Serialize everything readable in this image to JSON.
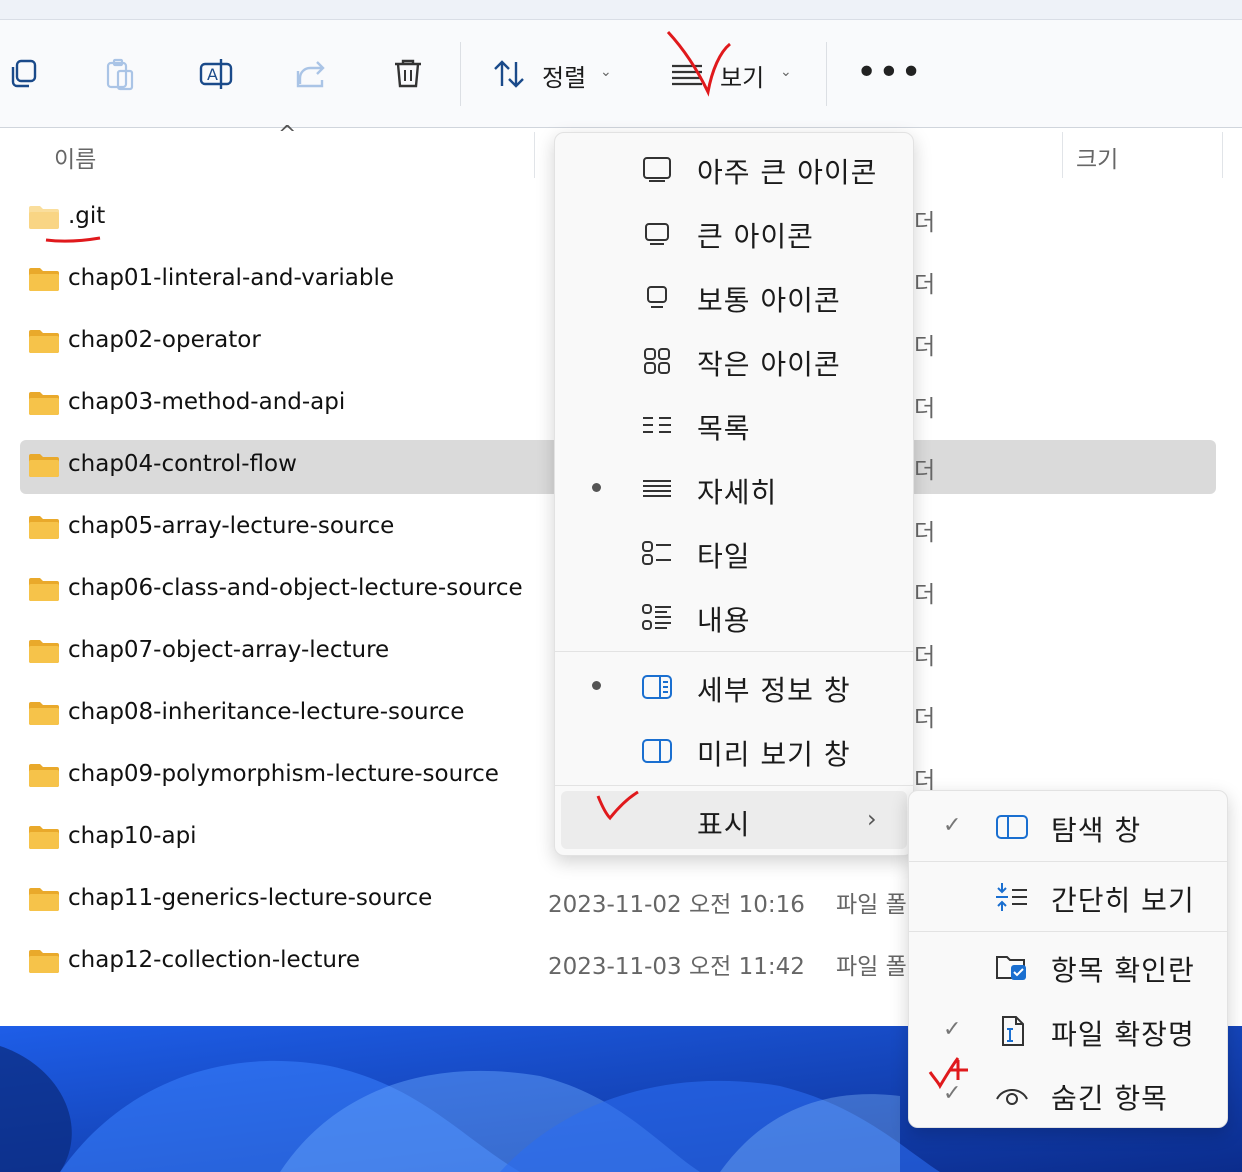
{
  "toolbar": {
    "sort_label": "정렬",
    "view_label": "보기",
    "more_label": "•••",
    "icons": [
      "copy-icon",
      "paste-icon",
      "rename-icon",
      "share-icon",
      "delete-icon",
      "sort-icon",
      "view-icon"
    ]
  },
  "columns": {
    "name": "이름",
    "size": "크기"
  },
  "files": [
    {
      "name": ".git",
      "date": "",
      "type": ""
    },
    {
      "name": "chap01-linteral-and-variable",
      "date": "",
      "type": ""
    },
    {
      "name": "chap02-operator",
      "date": "",
      "type": ""
    },
    {
      "name": "chap03-method-and-api",
      "date": "",
      "type": ""
    },
    {
      "name": "chap04-control-flow",
      "date": "",
      "type": "",
      "selected": true
    },
    {
      "name": "chap05-array-lecture-source",
      "date": "",
      "type": ""
    },
    {
      "name": "chap06-class-and-object-lecture-source",
      "date": "",
      "type": ""
    },
    {
      "name": "chap07-object-array-lecture",
      "date": "",
      "type": ""
    },
    {
      "name": "chap08-inheritance-lecture-source",
      "date": "",
      "type": ""
    },
    {
      "name": "chap09-polymorphism-lecture-source",
      "date": "",
      "type": ""
    },
    {
      "name": "chap10-api",
      "date": "",
      "type": ""
    },
    {
      "name": "chap11-generics-lecture-source",
      "date": "2023-11-02 오전 10:16",
      "type": "파일 폴"
    },
    {
      "name": "chap12-collection-lecture",
      "date": "2023-11-03 오전 11:42",
      "type": "파일 폴"
    }
  ],
  "clipped_type_suffix": "더",
  "view_menu": {
    "items": [
      {
        "label": "아주 큰 아이콘",
        "icon": "extra-large-icons-icon"
      },
      {
        "label": "큰 아이콘",
        "icon": "large-icons-icon"
      },
      {
        "label": "보통 아이콘",
        "icon": "medium-icons-icon"
      },
      {
        "label": "작은 아이콘",
        "icon": "small-icons-icon"
      },
      {
        "label": "목록",
        "icon": "list-icon"
      },
      {
        "label": "자세히",
        "icon": "details-icon",
        "active": true
      },
      {
        "label": "타일",
        "icon": "tiles-icon"
      },
      {
        "label": "내용",
        "icon": "content-icon"
      }
    ],
    "panes": [
      {
        "label": "세부 정보 창",
        "icon": "details-pane-icon",
        "active": true
      },
      {
        "label": "미리 보기 창",
        "icon": "preview-pane-icon"
      }
    ],
    "show_label": "표시"
  },
  "show_submenu": {
    "items": [
      {
        "label": "탐색 창",
        "icon": "navigation-pane-icon",
        "checked": true
      },
      {
        "label": "간단히 보기",
        "icon": "compact-view-icon",
        "checked": false
      },
      {
        "label": "항목 확인란",
        "icon": "item-checkbox-icon",
        "checked": false
      },
      {
        "label": "파일 확장명",
        "icon": "file-extension-icon",
        "checked": true
      },
      {
        "label": "숨긴 항목",
        "icon": "hidden-items-icon",
        "checked": true
      }
    ]
  },
  "colors": {
    "accent": "#0067c0",
    "annotation": "#e0191c",
    "folder": "#f6c34a",
    "selection": "#dadada"
  }
}
